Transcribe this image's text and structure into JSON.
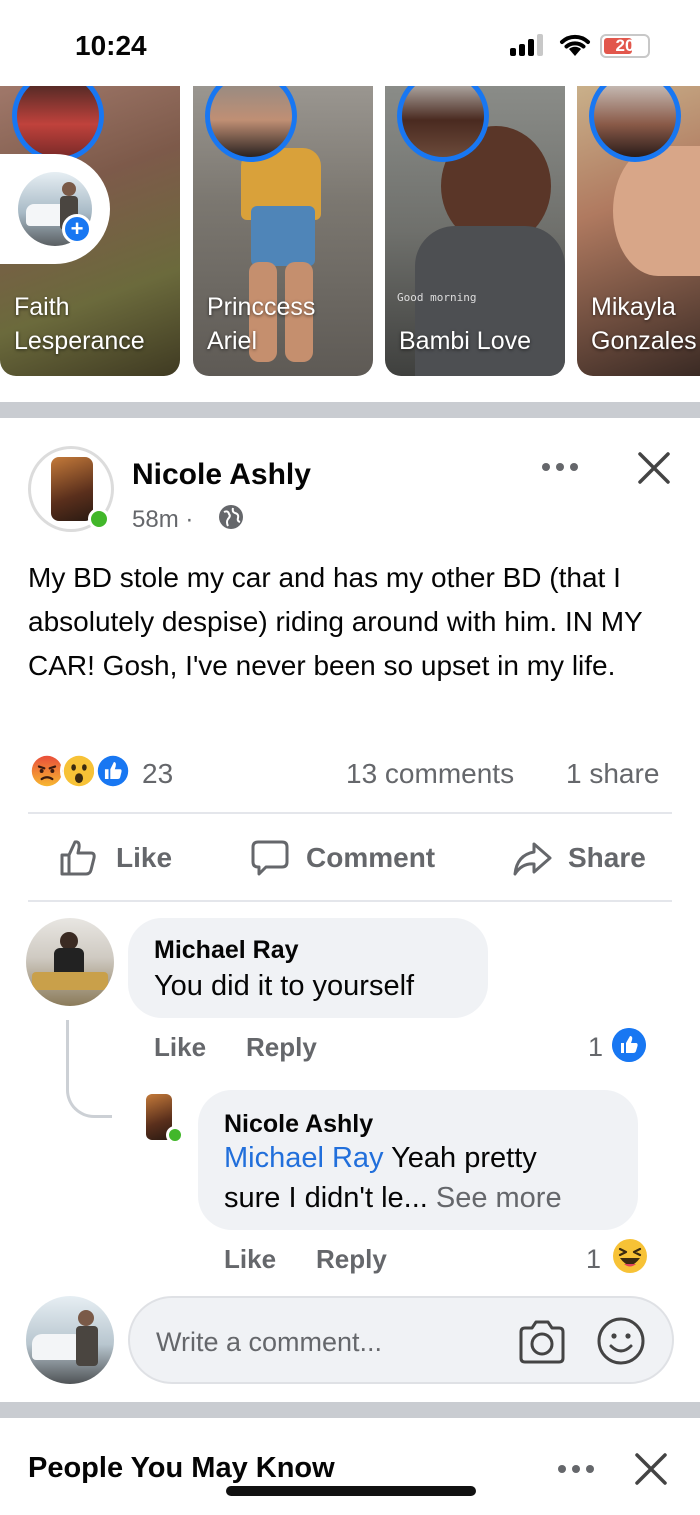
{
  "status_bar": {
    "time": "10:24",
    "battery": "20"
  },
  "stories": [
    {
      "name_line1": "Faith",
      "name_line2": "Lesperance"
    },
    {
      "name_line1": "Princcess",
      "name_line2": "Ariel"
    },
    {
      "name_line1": "",
      "name_line2": "Bambi Love",
      "overlay_text": "Good morning"
    },
    {
      "name_line1": "Mikayla",
      "name_line2": "Gonzales"
    }
  ],
  "post": {
    "author": "Nicole Ashly",
    "time": "58m ·",
    "text": "My BD stole my car and has my other BD (that I absolutely despise) riding around with him. IN MY CAR! Gosh, I've never been so upset in my life.",
    "reaction_count": "23",
    "comments_count": "13 comments",
    "shares_count": "1 share",
    "actions": {
      "like": "Like",
      "comment": "Comment",
      "share": "Share"
    }
  },
  "comments": [
    {
      "author": "Michael Ray",
      "text": "You did it to yourself",
      "like": "Like",
      "reply": "Reply",
      "reaction_count": "1",
      "reaction": "like-icon"
    }
  ],
  "reply": {
    "author": "Nicole Ashly",
    "mention": "Michael Ray",
    "text_line1": " Yeah pretty",
    "text_line2": "sure I didn't le...",
    "see_more": " See more",
    "like": "Like",
    "reply": "Reply",
    "reaction_count": "1",
    "reaction": "haha-icon"
  },
  "write_comment": {
    "placeholder": "Write a comment..."
  },
  "people_you_may_know": {
    "title": "People You May Know"
  },
  "colors": {
    "accent": "#1877f2",
    "online": "#42b72a",
    "muted": "#65676b",
    "bubble": "#f0f2f5"
  }
}
